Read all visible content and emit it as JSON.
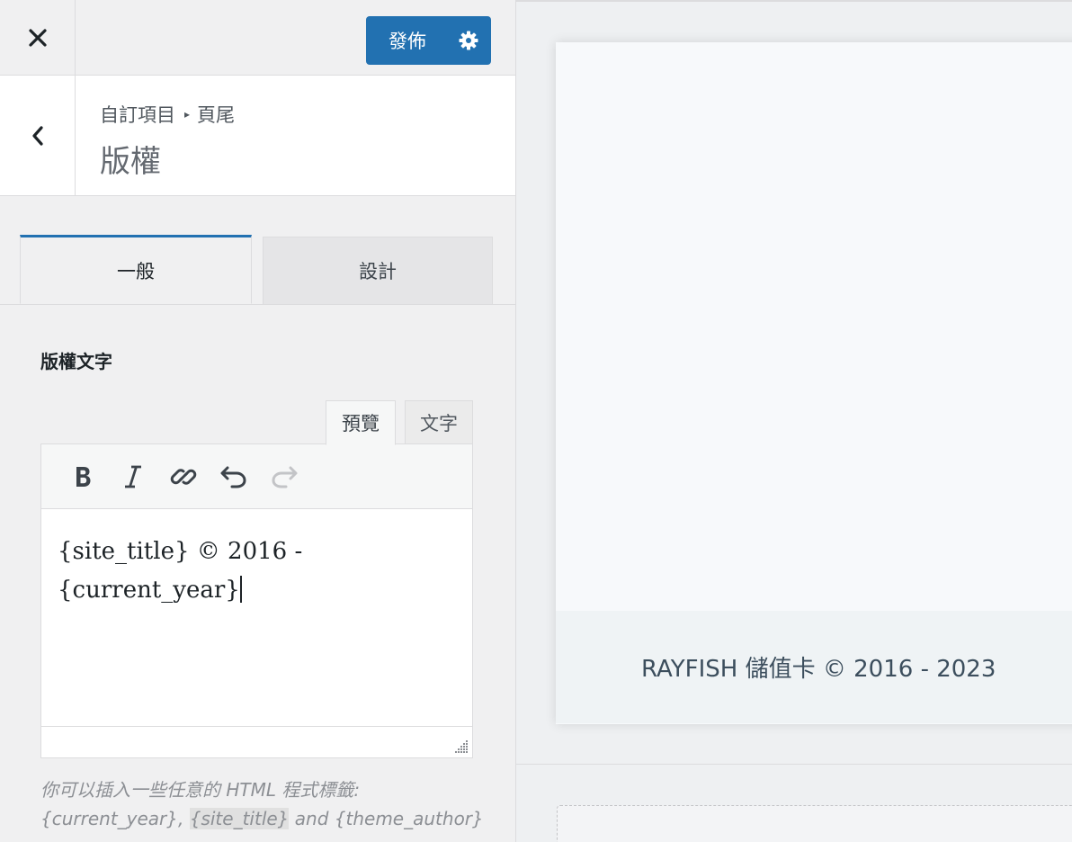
{
  "topbar": {
    "close_icon": "close-icon",
    "publish_label": "發佈",
    "publish_settings_icon": "gear-icon",
    "accent_color": "#2271b1"
  },
  "section": {
    "breadcrumb_root": "自訂項目",
    "breadcrumb_sep": "▸",
    "breadcrumb_current": "頁尾",
    "title": "版權"
  },
  "tabs": {
    "general": "一般",
    "design": "設計"
  },
  "field": {
    "label": "版權文字",
    "mode_preview": "預覽",
    "mode_text": "文字",
    "toolbar": [
      "bold-icon",
      "italic-icon",
      "link-icon",
      "undo-icon",
      "redo-icon"
    ],
    "content_line1": "{site_title} © 2016 -",
    "content_line2": "{current_year}",
    "help_text": "你可以插入一些任意的 HTML 程式標籤:",
    "help_tag1": "{current_year},",
    "help_tag2": "{site_title}",
    "help_and": "and",
    "help_tag3": "{theme_author}"
  },
  "preview": {
    "footer_text": "RAYFISH 儲值卡 © 2016 - 2023"
  }
}
